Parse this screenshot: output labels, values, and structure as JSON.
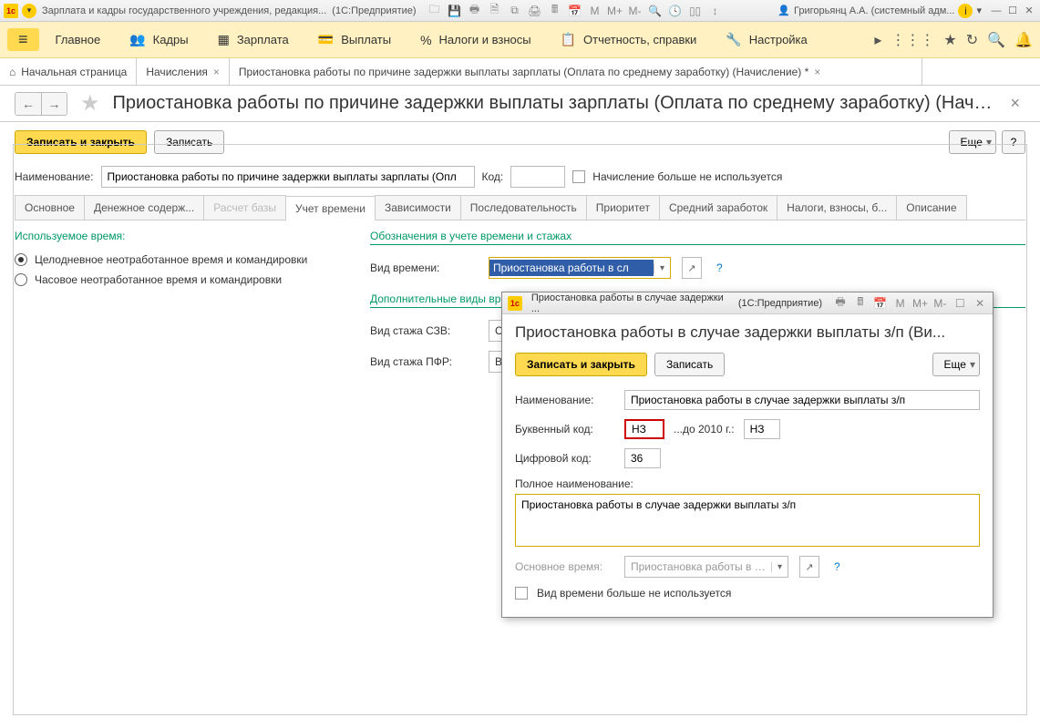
{
  "titlebar": {
    "app_title": "Зарплата и кадры государственного учреждения, редакция...",
    "platform": "(1С:Предприятие)",
    "user": "Григорьянц А.А. (системный адм..."
  },
  "mainmenu": {
    "hamburger": "≡",
    "items": [
      "Главное",
      "Кадры",
      "Зарплата",
      "Выплаты",
      "Налоги и взносы",
      "Отчетность, справки",
      "Настройка"
    ]
  },
  "page_tabs": {
    "home": "Начальная страница",
    "t1": "Начисления",
    "t2": "Приостановка работы по причине задержки выплаты зарплаты (Оплата по среднему заработку) (Начисление) *"
  },
  "page_title": "Приостановка работы по причине задержки выплаты зарплаты (Оплата по среднему заработку) (Начислени...",
  "actions": {
    "save_close": "Записать и закрыть",
    "save": "Записать",
    "more": "Еще",
    "help": "?"
  },
  "form": {
    "name_label": "Наименование:",
    "name_value": "Приостановка работы по причине задержки выплаты зарплаты (Опл",
    "code_label": "Код:",
    "code_value": "",
    "not_used_label": "Начисление больше не используется"
  },
  "inner_tabs": [
    "Основное",
    "Денежное содерж...",
    "Расчет базы",
    "Учет времени",
    "Зависимости",
    "Последовательность",
    "Приоритет",
    "Средний заработок",
    "Налоги, взносы, б...",
    "Описание"
  ],
  "time_tab": {
    "used_time_title": "Используемое время:",
    "radio1": "Целодневное неотработанное время и командировки",
    "radio2": "Часовое неотработанное время и командировки",
    "notation_title": "Обозначения в учете времени и стажах",
    "time_type_label": "Вид времени:",
    "time_type_value": "Приостановка работы в сл",
    "additional_title": "Дополнительные виды вр",
    "szv_label": "Вид стажа СЗВ:",
    "szv_value": "Стаж д",
    "pfr_label": "Вид стажа ПФР:",
    "pfr_value": "Включа"
  },
  "dialog": {
    "window_title": "Приостановка работы в случае задержки ...",
    "platform": "(1С:Предприятие)",
    "title": "Приостановка работы в случае задержки выплаты з/п (Ви...",
    "save_close": "Записать и закрыть",
    "save": "Записать",
    "more": "Еще",
    "name_label": "Наименование:",
    "name_value": "Приостановка работы в случае задержки выплаты з/п",
    "letter_code_label": "Буквенный код:",
    "letter_code_value": "НЗ",
    "until_2010_label": "...до 2010 г.:",
    "until_2010_value": "НЗ",
    "digit_code_label": "Цифровой код:",
    "digit_code_value": "36",
    "full_name_label": "Полное наименование:",
    "full_name_value": "Приостановка работы в случае задержки выплаты з/п",
    "base_time_label": "Основное время:",
    "base_time_value": "Приостановка работы в сл",
    "not_used_label": "Вид времени больше не используется"
  }
}
